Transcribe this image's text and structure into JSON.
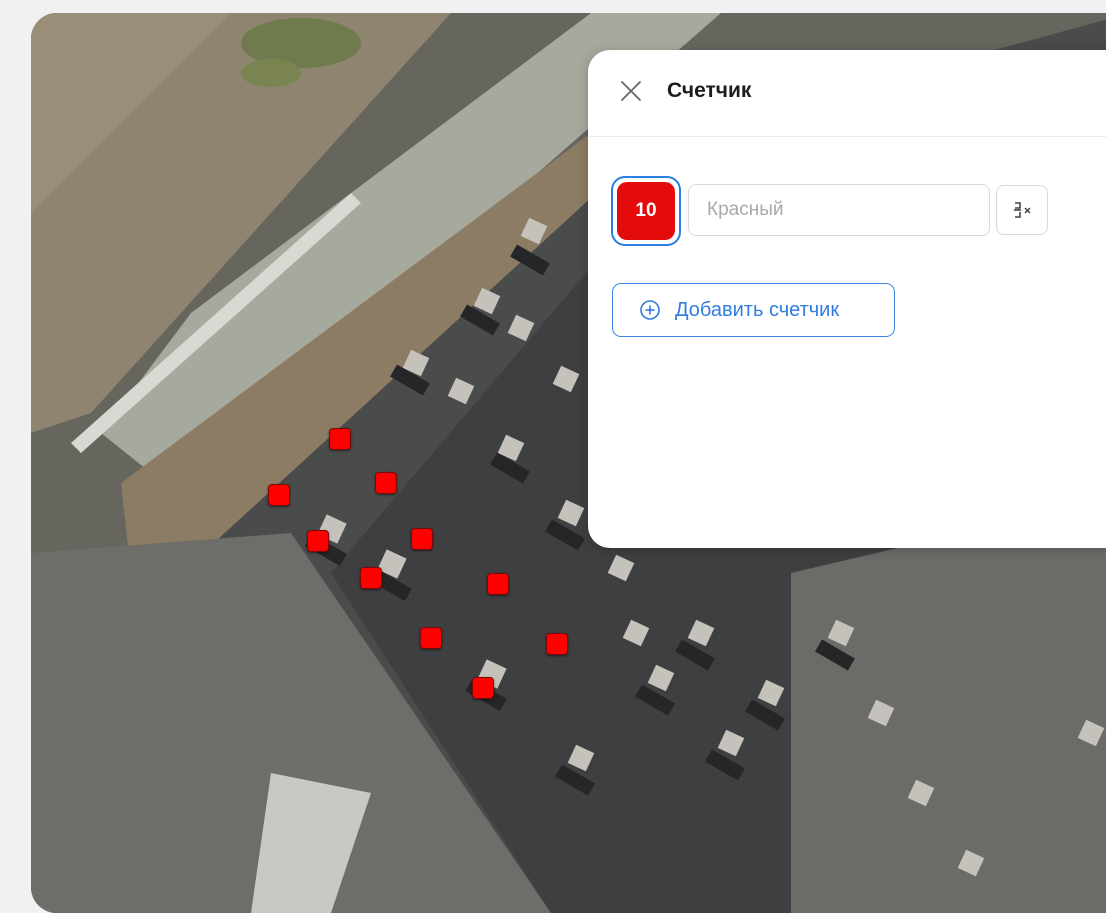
{
  "panel": {
    "title": "Счетчик",
    "close_icon": "close-icon",
    "counter": {
      "value": "10",
      "color": "#e30b0b",
      "name_placeholder": "Красный",
      "name_value": "",
      "clear_icon": "clear-format-icon"
    },
    "add_button_label": "Добавить счетчик",
    "add_icon": "plus-circle-icon"
  },
  "map": {
    "marker_color": "#ff0000",
    "marker_count": 10
  }
}
